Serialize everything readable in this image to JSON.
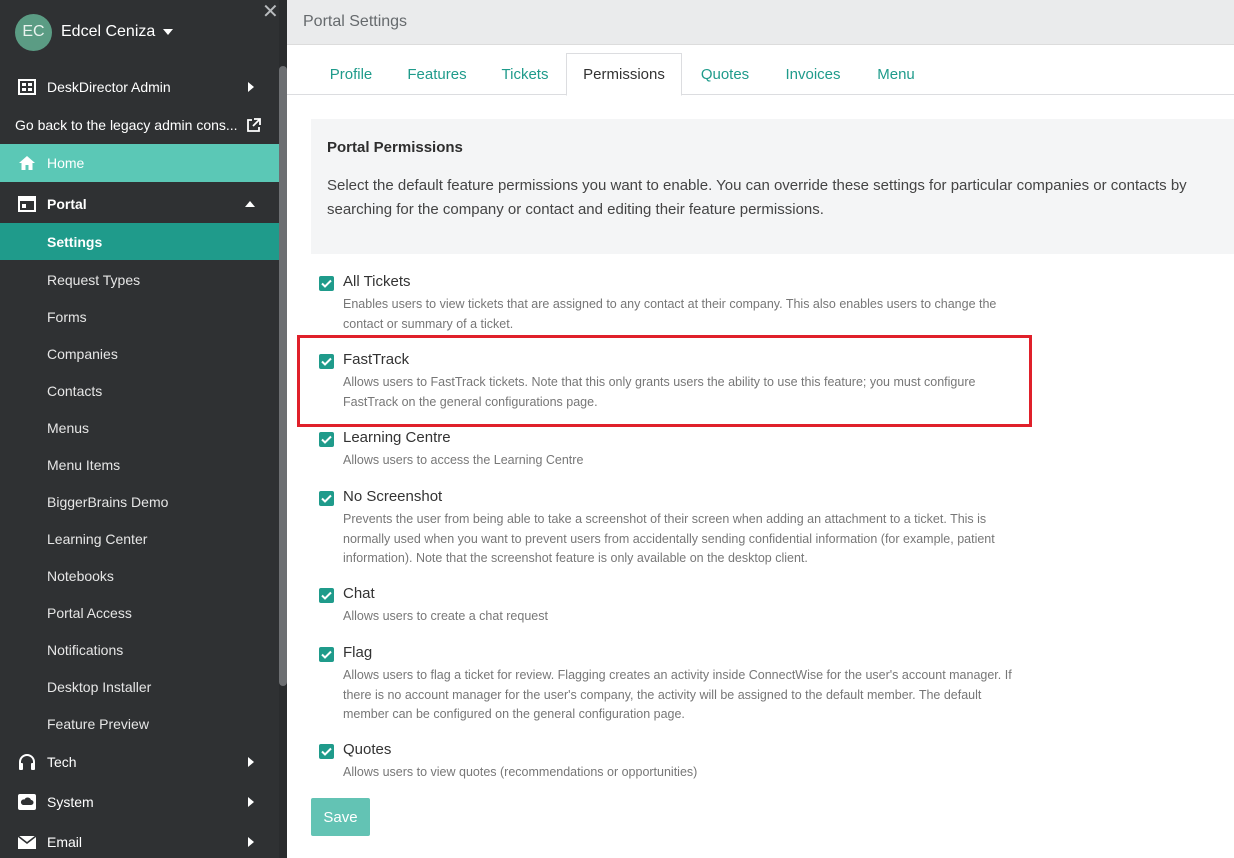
{
  "sidebar": {
    "user": {
      "initials": "EC",
      "name": "Edcel Ceniza"
    },
    "admin_label": "DeskDirector Admin",
    "legacy_label": "Go back to the legacy admin cons...",
    "home_label": "Home",
    "portal_label": "Portal",
    "settings_label": "Settings",
    "sub_items": [
      "Request Types",
      "Forms",
      "Companies",
      "Contacts",
      "Menus",
      "Menu Items",
      "BiggerBrains Demo",
      "Learning Center",
      "Notebooks",
      "Portal Access",
      "Notifications",
      "Desktop Installer",
      "Feature Preview"
    ],
    "tech_label": "Tech",
    "system_label": "System",
    "email_label": "Email"
  },
  "header": {
    "title": "Portal Settings"
  },
  "tabs": [
    "Profile",
    "Features",
    "Tickets",
    "Permissions",
    "Quotes",
    "Invoices",
    "Menu"
  ],
  "active_tab": "Permissions",
  "panel": {
    "title": "Portal Permissions",
    "description": "Select the default feature permissions you want to enable. You can override these settings for particular companies or contacts by searching for the company or contact and editing their feature permissions."
  },
  "permissions": [
    {
      "name": "All Tickets",
      "checked": true,
      "description": "Enables users to view tickets that are assigned to any contact at their company. This also enables users to change the contact or summary of a ticket."
    },
    {
      "name": "FastTrack",
      "checked": true,
      "description": "Allows users to FastTrack tickets. Note that this only grants users the ability to use this feature; you must configure FastTrack on the general configurations page."
    },
    {
      "name": "Learning Centre",
      "checked": true,
      "description": "Allows users to access the Learning Centre"
    },
    {
      "name": "No Screenshot",
      "checked": true,
      "description": "Prevents the user from being able to take a screenshot of their screen when adding an attachment to a ticket. This is normally used when you want to prevent users from accidentally sending confidential information (for example, patient information). Note that the screenshot feature is only available on the desktop client."
    },
    {
      "name": "Chat",
      "checked": true,
      "description": "Allows users to create a chat request"
    },
    {
      "name": "Flag",
      "checked": true,
      "description": "Allows users to flag a ticket for review. Flagging creates an activity inside ConnectWise for the user's account manager. If there is no account manager for the user's company, the activity will be assigned to the default member. The default member can be configured on the general configuration page."
    },
    {
      "name": "Quotes",
      "checked": true,
      "description": "Allows users to view quotes (recommendations or opportunities)"
    }
  ],
  "save_label": "Save",
  "colors": {
    "accent": "#1f9b8b",
    "home_highlight": "#5bc8b6",
    "sidebar_bg": "#2f3133",
    "annotation_red": "#e0202a"
  }
}
